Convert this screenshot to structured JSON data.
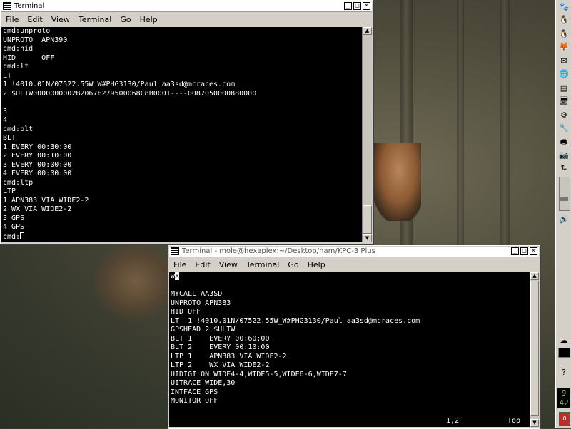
{
  "desktop": {
    "panel_icons": [
      "gnome-foot-icon",
      "tux-icon",
      "tux-icon",
      "firefox-icon",
      "mail-icon",
      "globe-icon",
      "terminal-icon",
      "monitor-icon",
      "settings-icon",
      "wrench-icon",
      "printer-icon",
      "camera-icon",
      "network-icon",
      "volume-icon",
      "weather-icon",
      "help-icon"
    ],
    "clock": "9\n42",
    "battery": "0",
    "help_label": "?",
    "volume_level": 0.3
  },
  "window1": {
    "title": "Terminal",
    "menu": [
      "File",
      "Edit",
      "View",
      "Terminal",
      "Go",
      "Help"
    ],
    "lines": [
      "cmd:unproto",
      "UNPROTO  APN390",
      "cmd:hid",
      "HID      OFF",
      "cmd:lt",
      "LT",
      "1 !4010.01N/07522.55W_W#PHG3130/Paul aa3sd@mcraces.com",
      "2 $ULTW0000000002B2067E279500068C8B0001----0087050000880000",
      "",
      "3",
      "4",
      "cmd:blt",
      "BLT",
      "1 EVERY 00:30:00",
      "2 EVERY 00:10:00",
      "3 EVERY 00:00:00",
      "4 EVERY 00:00:00",
      "cmd:ltp",
      "LTP",
      "1 APN383 VIA WIDE2-2",
      "2 WX VIA WIDE2-2",
      "3 GPS",
      "4 GPS"
    ],
    "prompt": "cmd:",
    "buttons": {
      "minimize": "_",
      "maximize": "□",
      "close": "×"
    }
  },
  "window2": {
    "title": "Terminal - mole@hexaplex:~/Desktop/ham/KPC-3 Plus",
    "menu": [
      "File",
      "Edit",
      "View",
      "Terminal",
      "Go",
      "Help"
    ],
    "first_line_text": "wx",
    "lines": [
      "",
      "MYCALL AA3SD",
      "UNPROTO APN383",
      "HID OFF",
      "LT  1 !4010.01N/07522.55W_W#PHG3130/Paul aa3sd@mcraces.com",
      "GPSHEAD 2 $ULTW",
      "BLT 1    EVERY 00:60:00",
      "BLT 2    EVERY 00:10:00",
      "LTP 1    APN383 VIA WIDE2-2",
      "LTP 2    WX VIA WIDE2-2",
      "UIDIGI ON WIDE4-4,WIDE5-5,WIDE6-6,WIDE7-7",
      "UITRACE WIDE,30",
      "INTFACE GPS",
      "MONITOR OFF"
    ],
    "status_position": "1,2",
    "status_scroll": "Top",
    "buttons": {
      "minimize": "_",
      "maximize": "□",
      "close": "×"
    }
  }
}
